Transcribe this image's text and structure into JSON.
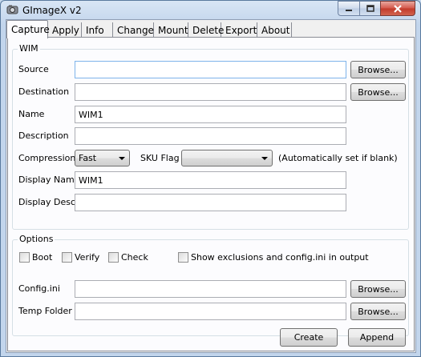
{
  "window": {
    "title": "GImageX v2"
  },
  "tabs": [
    "Capture",
    "Apply",
    "Info",
    "Change",
    "Mount",
    "Delete",
    "Export",
    "About"
  ],
  "wim": {
    "legend": "WIM",
    "source_label": "Source",
    "source_value": "",
    "destination_label": "Destination",
    "destination_value": "",
    "name_label": "Name",
    "name_value": "WIM1",
    "description_label": "Description",
    "description_value": "",
    "compression_label": "Compression",
    "compression_value": "Fast",
    "sku_label": "SKU Flag",
    "sku_value": "",
    "sku_hint": "(Automatically set if blank)",
    "display_name_label": "Display Name",
    "display_name_value": "WIM1",
    "display_desc_label": "Display Desc.",
    "display_desc_value": "",
    "browse_label": "Browse..."
  },
  "options": {
    "legend": "Options",
    "boot_label": "Boot",
    "verify_label": "Verify",
    "check_label": "Check",
    "show_exclusions_label": "Show exclusions and config.ini in output",
    "config_label": "Config.ini",
    "config_value": "",
    "temp_label": "Temp Folder",
    "temp_value": "",
    "browse_label": "Browse..."
  },
  "actions": {
    "create_label": "Create",
    "append_label": "Append"
  }
}
